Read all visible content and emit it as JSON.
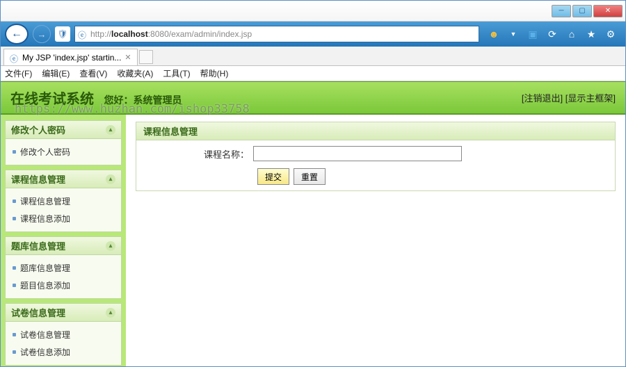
{
  "browser": {
    "url_prefix": "http://",
    "url_host": "localhost",
    "url_port": ":8080",
    "url_path": "/exam/admin/index.jsp",
    "tab_title": "My JSP 'index.jsp' startin...",
    "menus": [
      "文件(F)",
      "编辑(E)",
      "查看(V)",
      "收藏夹(A)",
      "工具(T)",
      "帮助(H)"
    ]
  },
  "header": {
    "system_name": "在线考试系统",
    "greet_label": "您好：",
    "username": "系统管理员",
    "logout": "[注销退出]",
    "show_frame": "[显示主框架]",
    "watermark": "https://www.huzhan.com/ishop33758"
  },
  "sidebar": {
    "groups": [
      {
        "title": "修改个人密码",
        "items": [
          "修改个人密码"
        ]
      },
      {
        "title": "课程信息管理",
        "items": [
          "课程信息管理",
          "课程信息添加"
        ]
      },
      {
        "title": "题库信息管理",
        "items": [
          "题库信息管理",
          "题目信息添加"
        ]
      },
      {
        "title": "试卷信息管理",
        "items": [
          "试卷信息管理",
          "试卷信息添加"
        ]
      }
    ]
  },
  "panel": {
    "title": "课程信息管理",
    "field_label": "课程名称：",
    "field_value": "",
    "submit": "提交",
    "reset": "重置"
  }
}
